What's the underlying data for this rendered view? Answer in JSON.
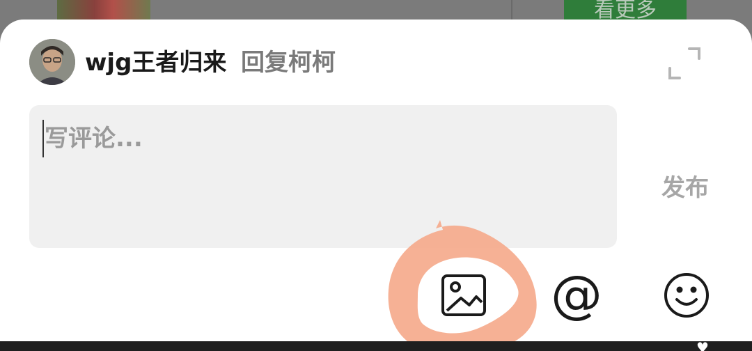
{
  "background": {
    "more_button_label": "看更多"
  },
  "composer": {
    "user_name": "wjg王者归来",
    "reply_label": "回复柯柯",
    "placeholder": "写评论...",
    "publish_label": "发布",
    "at_symbol": "@"
  },
  "icons": {
    "expand": "expand-icon",
    "image": "image-icon",
    "mention": "at-icon",
    "emoji": "emoji-icon"
  },
  "colors": {
    "publish_disabled": "#a6a6a6",
    "input_bg": "#f0f0f0",
    "highlight": "#f5a98a"
  }
}
